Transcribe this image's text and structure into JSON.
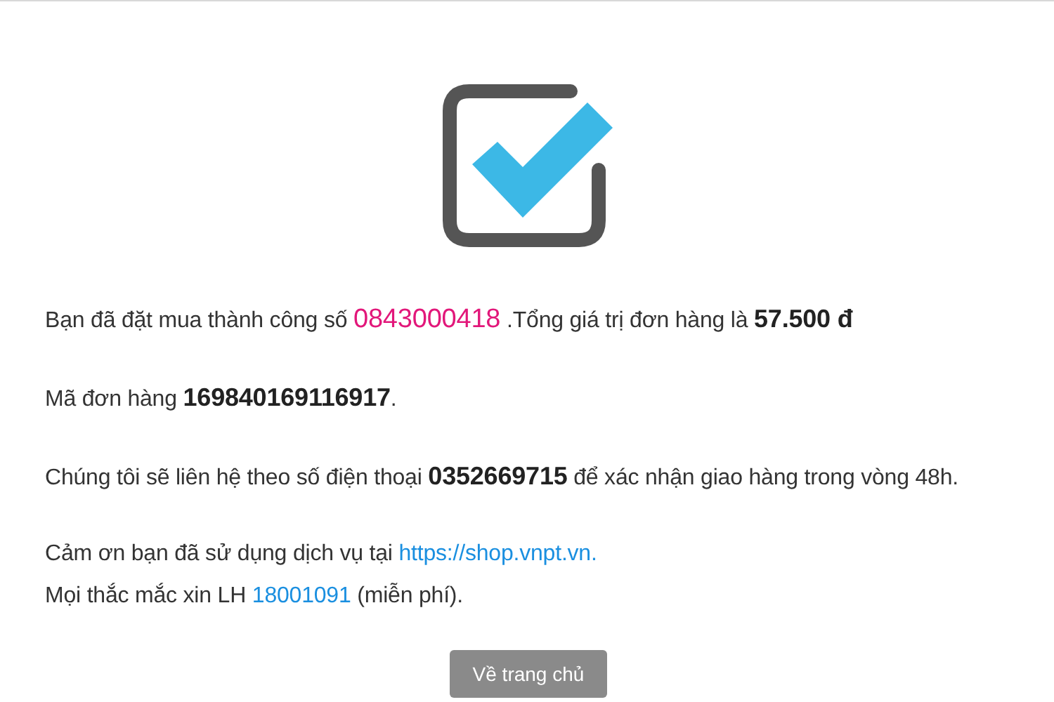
{
  "sections": [
    {
      "lines": [
        {
          "segments": [
            {
              "kind": "text",
              "text": "Bạn đã đặt mua thành công số "
            },
            {
              "kind": "highlight",
              "text": "0843000418"
            },
            {
              "kind": "text",
              "text": " .Tổng giá trị đơn hàng là "
            },
            {
              "kind": "bold",
              "text": "57.500 đ"
            }
          ]
        }
      ]
    },
    {
      "lines": [
        {
          "segments": [
            {
              "kind": "text",
              "text": "Mã đơn hàng "
            },
            {
              "kind": "bold",
              "text": "169840169116917"
            },
            {
              "kind": "text",
              "text": "."
            }
          ]
        }
      ]
    },
    {
      "lines": [
        {
          "segments": [
            {
              "kind": "text",
              "text": "Chúng tôi sẽ liên hệ theo số điện thoại "
            },
            {
              "kind": "bold",
              "text": "0352669715"
            },
            {
              "kind": "text",
              "text": " để xác nhận giao hàng trong vòng 48h."
            }
          ]
        }
      ]
    },
    {
      "lines": [
        {
          "segments": [
            {
              "kind": "text",
              "text": "Cảm ơn bạn đã sử dụng dịch vụ tại "
            },
            {
              "kind": "link",
              "text": "https://shop.vnpt.vn."
            }
          ]
        },
        {
          "segments": [
            {
              "kind": "text",
              "text": "Mọi thắc mắc xin LH "
            },
            {
              "kind": "link",
              "text": "18001091"
            },
            {
              "kind": "text",
              "text": " (miễn phí)."
            }
          ]
        }
      ]
    }
  ],
  "button": {
    "label": "Về trang chủ"
  }
}
